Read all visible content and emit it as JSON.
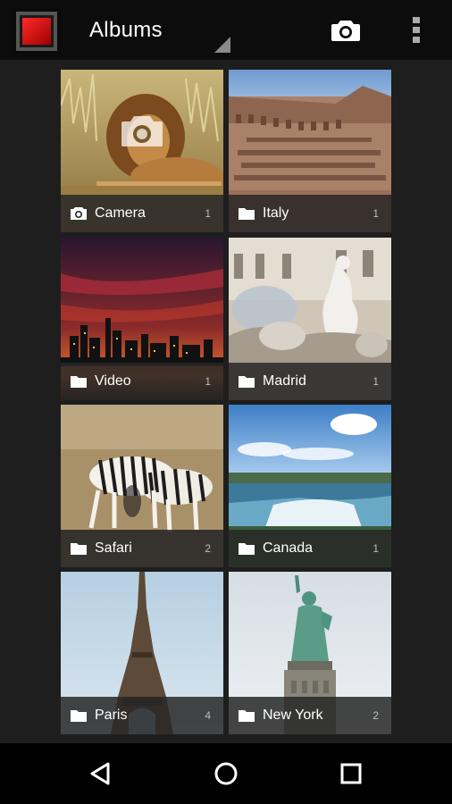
{
  "action_bar": {
    "title": "Albums",
    "camera_icon": "camera-icon",
    "overflow_icon": "more-vert-icon"
  },
  "albums": [
    {
      "name": "Camera",
      "count": "1",
      "icon": "camera-icon"
    },
    {
      "name": "Italy",
      "count": "1",
      "icon": "folder-icon"
    },
    {
      "name": "Video",
      "count": "1",
      "icon": "folder-icon"
    },
    {
      "name": "Madrid",
      "count": "1",
      "icon": "folder-icon"
    },
    {
      "name": "Safari",
      "count": "2",
      "icon": "folder-icon"
    },
    {
      "name": "Canada",
      "count": "1",
      "icon": "folder-icon"
    },
    {
      "name": "Paris",
      "count": "4",
      "icon": "folder-icon"
    },
    {
      "name": "New York",
      "count": "2",
      "icon": "folder-icon"
    }
  ],
  "nav_bar": {
    "back_icon": "back-icon",
    "home_icon": "home-icon",
    "recents_icon": "recents-icon"
  },
  "colors": {
    "action_bar_bg": "#0c0c0c",
    "grid_bg": "#1e1e1e",
    "label_bg": "#282828",
    "nav_bar_bg": "#000000",
    "app_icon_red": "#d40000"
  }
}
